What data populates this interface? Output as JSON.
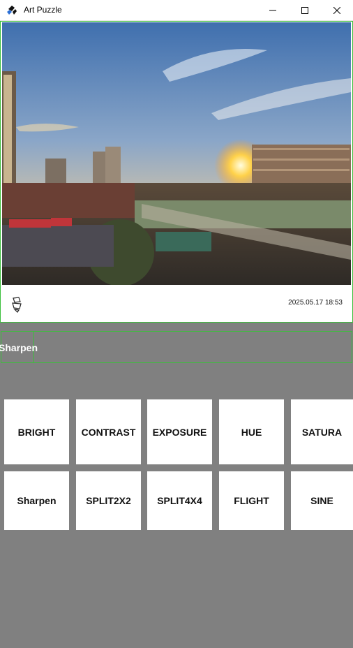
{
  "window": {
    "title": "Art Puzzle"
  },
  "photo": {
    "timestamp": "2025.05.17 18:53"
  },
  "selected_effect": "Sharpen",
  "effects_row1": [
    "BRIGHT",
    "CONTRAST",
    "EXPOSURE",
    "HUE",
    "SATURA"
  ],
  "effects_row2": [
    "Sharpen",
    "SPLIT2X2",
    "SPLIT4X4",
    "FLIGHT",
    "SINE"
  ],
  "colors": {
    "background": "#808080",
    "selection_border": "#3bbf3b",
    "button_bg": "#ffffff"
  }
}
